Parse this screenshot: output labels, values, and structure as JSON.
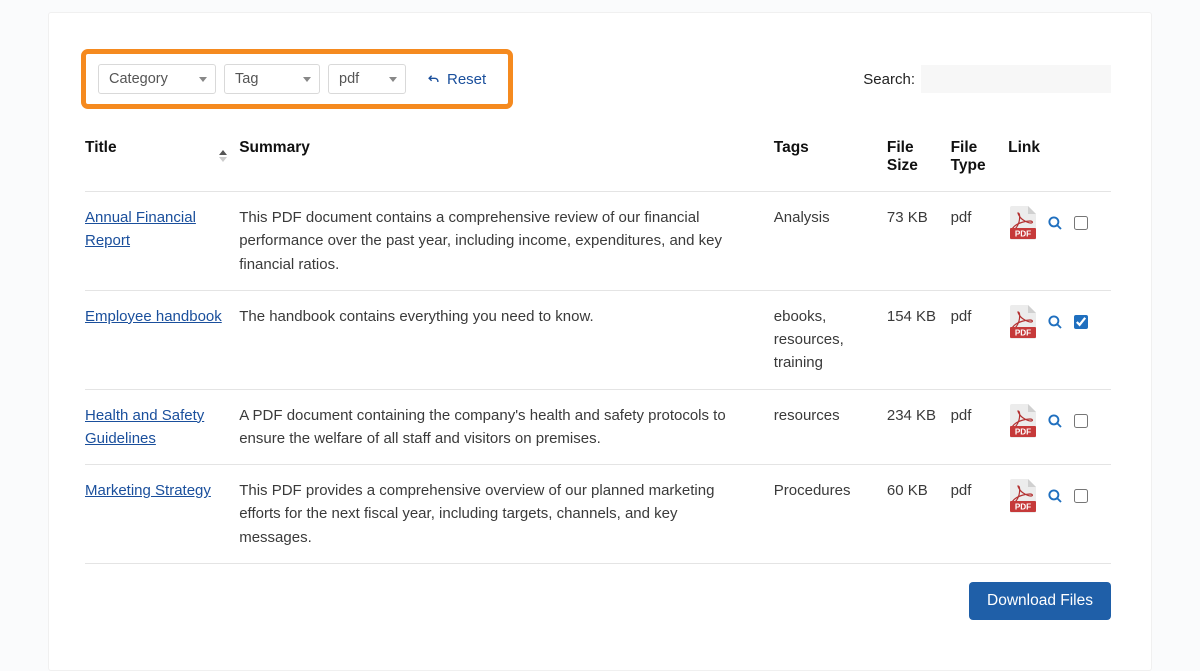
{
  "filters": {
    "category": "Category",
    "tag": "Tag",
    "filetype": "pdf",
    "reset": "Reset"
  },
  "search": {
    "label": "Search:",
    "value": ""
  },
  "columns": {
    "title": "Title",
    "summary": "Summary",
    "tags": "Tags",
    "size": "File Size",
    "type": "File Type",
    "link": "Link"
  },
  "rows": [
    {
      "title": "Annual Financial Report",
      "summary": "This PDF document contains a comprehensive review of our financial performance over the past year, including income, expenditures, and key financial ratios.",
      "tags": "Analysis",
      "size": "73 KB",
      "type": "pdf",
      "checked": false
    },
    {
      "title": "Employee handbook",
      "summary": "The handbook contains everything you need to know.",
      "tags": "ebooks, resources, training",
      "size": "154 KB",
      "type": "pdf",
      "checked": true
    },
    {
      "title": "Health and Safety Guidelines",
      "summary": "A PDF document containing the company's health and safety protocols to ensure the welfare of all staff and visitors on premises.",
      "tags": "resources",
      "size": "234 KB",
      "type": "pdf",
      "checked": false
    },
    {
      "title": "Marketing Strategy",
      "summary": "This PDF provides a comprehensive overview of our planned marketing efforts for the next fiscal year, including targets, channels, and key messages.",
      "tags": "Procedures",
      "size": "60 KB",
      "type": "pdf",
      "checked": false
    }
  ],
  "download_button": "Download Files"
}
